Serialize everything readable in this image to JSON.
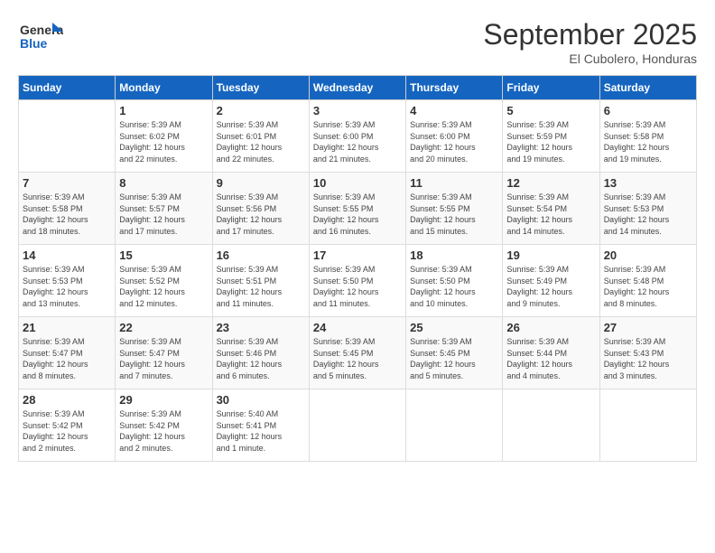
{
  "header": {
    "logo_general": "General",
    "logo_blue": "Blue",
    "title": "September 2025",
    "location": "El Cubolero, Honduras"
  },
  "columns": [
    "Sunday",
    "Monday",
    "Tuesday",
    "Wednesday",
    "Thursday",
    "Friday",
    "Saturday"
  ],
  "weeks": [
    [
      {
        "num": "",
        "detail": ""
      },
      {
        "num": "1",
        "detail": "Sunrise: 5:39 AM\nSunset: 6:02 PM\nDaylight: 12 hours\nand 22 minutes."
      },
      {
        "num": "2",
        "detail": "Sunrise: 5:39 AM\nSunset: 6:01 PM\nDaylight: 12 hours\nand 22 minutes."
      },
      {
        "num": "3",
        "detail": "Sunrise: 5:39 AM\nSunset: 6:00 PM\nDaylight: 12 hours\nand 21 minutes."
      },
      {
        "num": "4",
        "detail": "Sunrise: 5:39 AM\nSunset: 6:00 PM\nDaylight: 12 hours\nand 20 minutes."
      },
      {
        "num": "5",
        "detail": "Sunrise: 5:39 AM\nSunset: 5:59 PM\nDaylight: 12 hours\nand 19 minutes."
      },
      {
        "num": "6",
        "detail": "Sunrise: 5:39 AM\nSunset: 5:58 PM\nDaylight: 12 hours\nand 19 minutes."
      }
    ],
    [
      {
        "num": "7",
        "detail": "Sunrise: 5:39 AM\nSunset: 5:58 PM\nDaylight: 12 hours\nand 18 minutes."
      },
      {
        "num": "8",
        "detail": "Sunrise: 5:39 AM\nSunset: 5:57 PM\nDaylight: 12 hours\nand 17 minutes."
      },
      {
        "num": "9",
        "detail": "Sunrise: 5:39 AM\nSunset: 5:56 PM\nDaylight: 12 hours\nand 17 minutes."
      },
      {
        "num": "10",
        "detail": "Sunrise: 5:39 AM\nSunset: 5:55 PM\nDaylight: 12 hours\nand 16 minutes."
      },
      {
        "num": "11",
        "detail": "Sunrise: 5:39 AM\nSunset: 5:55 PM\nDaylight: 12 hours\nand 15 minutes."
      },
      {
        "num": "12",
        "detail": "Sunrise: 5:39 AM\nSunset: 5:54 PM\nDaylight: 12 hours\nand 14 minutes."
      },
      {
        "num": "13",
        "detail": "Sunrise: 5:39 AM\nSunset: 5:53 PM\nDaylight: 12 hours\nand 14 minutes."
      }
    ],
    [
      {
        "num": "14",
        "detail": "Sunrise: 5:39 AM\nSunset: 5:53 PM\nDaylight: 12 hours\nand 13 minutes."
      },
      {
        "num": "15",
        "detail": "Sunrise: 5:39 AM\nSunset: 5:52 PM\nDaylight: 12 hours\nand 12 minutes."
      },
      {
        "num": "16",
        "detail": "Sunrise: 5:39 AM\nSunset: 5:51 PM\nDaylight: 12 hours\nand 11 minutes."
      },
      {
        "num": "17",
        "detail": "Sunrise: 5:39 AM\nSunset: 5:50 PM\nDaylight: 12 hours\nand 11 minutes."
      },
      {
        "num": "18",
        "detail": "Sunrise: 5:39 AM\nSunset: 5:50 PM\nDaylight: 12 hours\nand 10 minutes."
      },
      {
        "num": "19",
        "detail": "Sunrise: 5:39 AM\nSunset: 5:49 PM\nDaylight: 12 hours\nand 9 minutes."
      },
      {
        "num": "20",
        "detail": "Sunrise: 5:39 AM\nSunset: 5:48 PM\nDaylight: 12 hours\nand 8 minutes."
      }
    ],
    [
      {
        "num": "21",
        "detail": "Sunrise: 5:39 AM\nSunset: 5:47 PM\nDaylight: 12 hours\nand 8 minutes."
      },
      {
        "num": "22",
        "detail": "Sunrise: 5:39 AM\nSunset: 5:47 PM\nDaylight: 12 hours\nand 7 minutes."
      },
      {
        "num": "23",
        "detail": "Sunrise: 5:39 AM\nSunset: 5:46 PM\nDaylight: 12 hours\nand 6 minutes."
      },
      {
        "num": "24",
        "detail": "Sunrise: 5:39 AM\nSunset: 5:45 PM\nDaylight: 12 hours\nand 5 minutes."
      },
      {
        "num": "25",
        "detail": "Sunrise: 5:39 AM\nSunset: 5:45 PM\nDaylight: 12 hours\nand 5 minutes."
      },
      {
        "num": "26",
        "detail": "Sunrise: 5:39 AM\nSunset: 5:44 PM\nDaylight: 12 hours\nand 4 minutes."
      },
      {
        "num": "27",
        "detail": "Sunrise: 5:39 AM\nSunset: 5:43 PM\nDaylight: 12 hours\nand 3 minutes."
      }
    ],
    [
      {
        "num": "28",
        "detail": "Sunrise: 5:39 AM\nSunset: 5:42 PM\nDaylight: 12 hours\nand 2 minutes."
      },
      {
        "num": "29",
        "detail": "Sunrise: 5:39 AM\nSunset: 5:42 PM\nDaylight: 12 hours\nand 2 minutes."
      },
      {
        "num": "30",
        "detail": "Sunrise: 5:40 AM\nSunset: 5:41 PM\nDaylight: 12 hours\nand 1 minute."
      },
      {
        "num": "",
        "detail": ""
      },
      {
        "num": "",
        "detail": ""
      },
      {
        "num": "",
        "detail": ""
      },
      {
        "num": "",
        "detail": ""
      }
    ]
  ]
}
